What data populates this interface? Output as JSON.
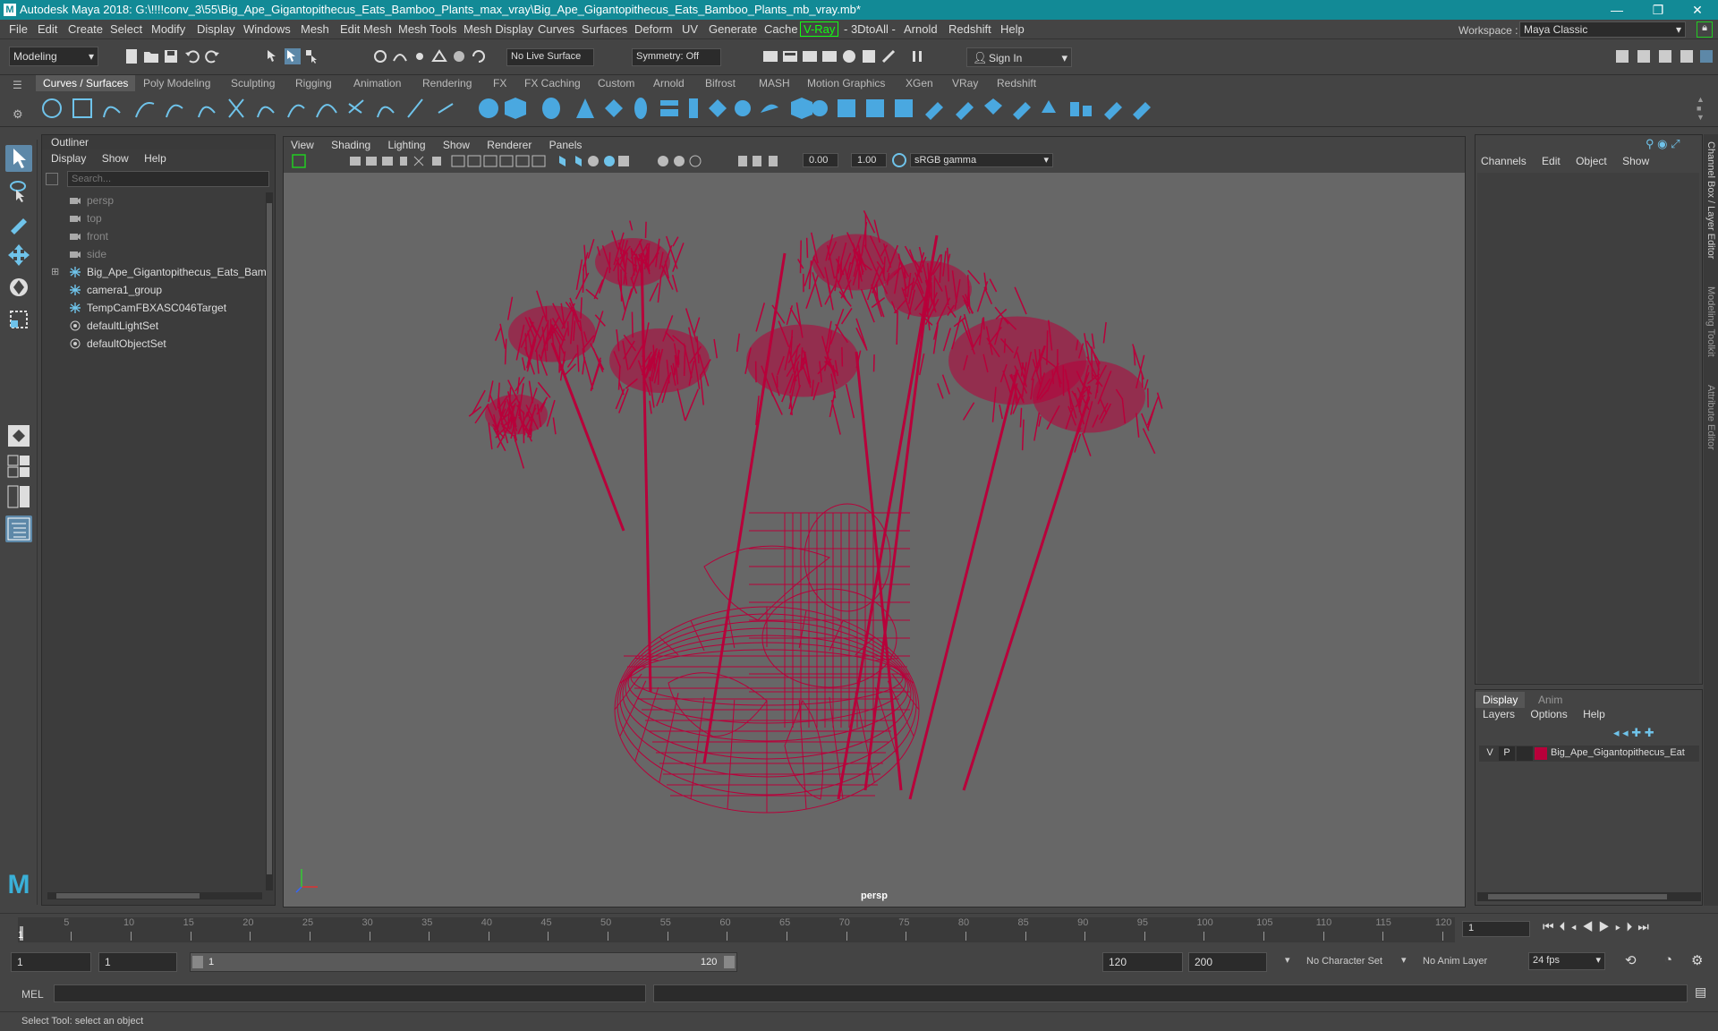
{
  "window": {
    "title": "Autodesk Maya 2018: G:\\!!!!conv_3\\55\\Big_Ape_Gigantopithecus_Eats_Bamboo_Plants_max_vray\\Big_Ape_Gigantopithecus_Eats_Bamboo_Plants_mb_vray.mb*",
    "controls": [
      "—",
      "❐",
      "✕"
    ]
  },
  "menubar": {
    "items": [
      "File",
      "Edit",
      "Create",
      "Select",
      "Modify",
      "Display",
      "Windows",
      "Mesh",
      "Edit Mesh",
      "Mesh Tools",
      "Mesh Display",
      "Curves",
      "Surfaces",
      "Deform",
      "UV",
      "Generate",
      "Cache",
      "V-Ray",
      "- 3DtoAll -",
      "Arnold",
      "Redshift",
      "Help"
    ],
    "workspace_label": "Workspace :",
    "workspace_value": "Maya Classic"
  },
  "statusline": {
    "mode": "Modeling",
    "live_surface": "No Live Surface",
    "symmetry": "Symmetry: Off",
    "sign_in": "Sign In"
  },
  "shelf": {
    "tabs": [
      "Curves / Surfaces",
      "Poly Modeling",
      "Sculpting",
      "Rigging",
      "Animation",
      "Rendering",
      "FX",
      "FX Caching",
      "Custom",
      "Arnold",
      "Bifrost",
      "MASH",
      "Motion Graphics",
      "XGen",
      "VRay",
      "Redshift"
    ],
    "active_tab": "Curves / Surfaces"
  },
  "outliner": {
    "title": "Outliner",
    "menus": [
      "Display",
      "Show",
      "Help"
    ],
    "search_placeholder": "Search...",
    "items": [
      {
        "label": "persp",
        "icon": "camera-icon",
        "dim": true
      },
      {
        "label": "top",
        "icon": "camera-icon",
        "dim": true
      },
      {
        "label": "front",
        "icon": "camera-icon",
        "dim": true
      },
      {
        "label": "side",
        "icon": "camera-icon",
        "dim": true
      },
      {
        "label": "Big_Ape_Gigantopithecus_Eats_Bamb",
        "icon": "group-icon",
        "dim": false
      },
      {
        "label": "camera1_group",
        "icon": "group-icon",
        "dim": false
      },
      {
        "label": "TempCamFBXASC046Target",
        "icon": "locator-icon",
        "dim": false
      },
      {
        "label": "defaultLightSet",
        "icon": "set-icon",
        "dim": false
      },
      {
        "label": "defaultObjectSet",
        "icon": "set-icon",
        "dim": false
      }
    ]
  },
  "viewport": {
    "menus": [
      "View",
      "Shading",
      "Lighting",
      "Show",
      "Renderer",
      "Panels"
    ],
    "exposure": "0.00",
    "gamma": "1.00",
    "color_space": "sRGB gamma",
    "camera_label": "persp",
    "wireframe_color": "#b8003a"
  },
  "channelbox": {
    "menus": [
      "Channels",
      "Edit",
      "Object",
      "Show"
    ],
    "side_tabs": [
      "Channel Box / Layer Editor",
      "Modeling Toolkit",
      "Attribute Editor"
    ]
  },
  "layers": {
    "tabs": [
      "Display",
      "Anim"
    ],
    "menus": [
      "Layers",
      "Options",
      "Help"
    ],
    "layer": {
      "v": "V",
      "p": "P",
      "name": "Big_Ape_Gigantopithecus_Eat",
      "color": "#b8003a"
    }
  },
  "timeline": {
    "ticks": [
      "5",
      "10",
      "15",
      "20",
      "25",
      "30",
      "35",
      "40",
      "45",
      "50",
      "55",
      "60",
      "65",
      "70",
      "75",
      "80",
      "85",
      "90",
      "95",
      "100",
      "105",
      "110",
      "115",
      "120"
    ],
    "start_tick": "1",
    "current_frame": "1"
  },
  "range": {
    "start": "1",
    "anim_start": "1",
    "slider_start": "1",
    "slider_end": "120",
    "anim_end": "120",
    "end": "200",
    "character_set": "No Character Set",
    "anim_layer": "No Anim Layer",
    "fps": "24 fps"
  },
  "cmdline": {
    "label": "MEL"
  },
  "helpline": {
    "text": "Select Tool: select an object"
  }
}
